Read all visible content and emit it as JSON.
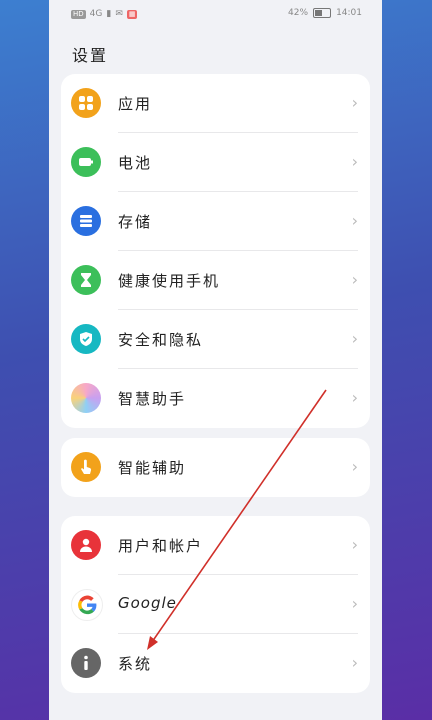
{
  "statusbar": {
    "left_chips": [
      "HD",
      "4G",
      "▮",
      "✉",
      "▦"
    ],
    "battery_percent": "42%",
    "time": "14:01",
    "battery_level": 0.42
  },
  "page": {
    "title": "设置"
  },
  "groups": [
    {
      "items": [
        {
          "label": "应用",
          "icon": "apps-icon",
          "color": "#f2a21b"
        },
        {
          "label": "电池",
          "icon": "battery-icon",
          "color": "#3cbf5a"
        },
        {
          "label": "存储",
          "icon": "storage-icon",
          "color": "#2a6fe0"
        },
        {
          "label": "健康使用手机",
          "icon": "hourglass-icon",
          "color": "#3cbf5a"
        },
        {
          "label": "安全和隐私",
          "icon": "shield-icon",
          "color": "#16b8c2"
        },
        {
          "label": "智慧助手",
          "icon": "assistant-icon",
          "color": "#c8a0f0"
        }
      ]
    },
    {
      "items": [
        {
          "label": "智能辅助",
          "icon": "hand-tap-icon",
          "color": "#f2a21b"
        }
      ]
    },
    {
      "items": [
        {
          "label": "用户和帐户",
          "icon": "user-icon",
          "color": "#e8333a"
        },
        {
          "label": "Google",
          "icon": "google-icon",
          "color": "#ffffff"
        },
        {
          "label": "系统",
          "icon": "info-icon",
          "color": "#666666"
        }
      ]
    }
  ],
  "chevron": "›",
  "annotation": {
    "color": "#d0302a"
  }
}
